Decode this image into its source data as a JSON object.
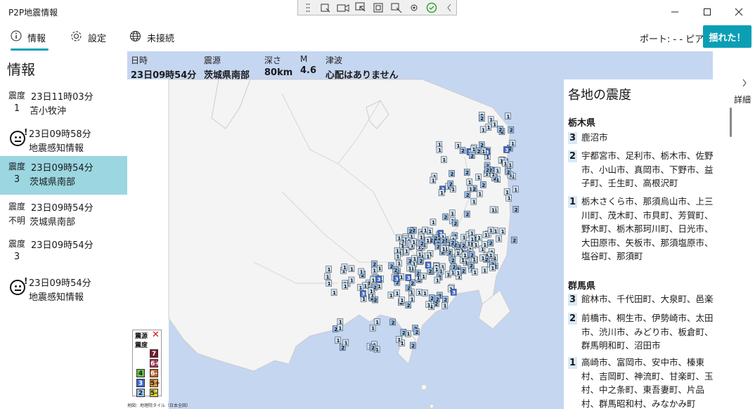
{
  "app_title": "P2P地震情報",
  "toolbar_icons": [
    "select-icon",
    "record-icon",
    "pointer-icon",
    "window-icon",
    "region-icon",
    "settings-icon",
    "check-icon",
    "chevron-left-icon"
  ],
  "nav": {
    "tabs": [
      {
        "icon": "info-icon",
        "label": "情報"
      },
      {
        "icon": "gear-icon",
        "label": "設定"
      },
      {
        "icon": "globe-icon",
        "label": "未接続"
      }
    ],
    "peer_label": "ポート: -  - ピア",
    "shake_button": "揺れた！"
  },
  "sidebar": {
    "title": "情報",
    "items": [
      {
        "type": "quake",
        "k": "震度",
        "intensity": "1",
        "time": "23日11時03分",
        "place": "苫小牧沖"
      },
      {
        "type": "report",
        "time": "23日09時58分",
        "place": "地震感知情報"
      },
      {
        "type": "quake",
        "k": "震度",
        "intensity": "3",
        "time": "23日09時54分",
        "place": "茨城県南部",
        "selected": true
      },
      {
        "type": "quake",
        "k": "震度",
        "intensity": "不明",
        "time": "23日09時54分",
        "place": "茨城県南部"
      },
      {
        "type": "quake",
        "k": "震度",
        "intensity": "3",
        "time": "23日09時54分",
        "place": ""
      },
      {
        "type": "report",
        "time": "23日09時54分",
        "place": "地震感知情報"
      }
    ]
  },
  "header": {
    "datetime_label": "日時",
    "datetime": "23日09時54分",
    "epicenter_label": "震源",
    "epicenter": "茨城県南部",
    "depth_label": "深さ",
    "depth": "80km",
    "mag_label": "M",
    "mag": "4.6",
    "tsunami_label": "津波",
    "tsunami": "心配はありません"
  },
  "detail": {
    "label": "詳細"
  },
  "panel": {
    "title": "各地の震度",
    "prefs": [
      {
        "name": "栃木県",
        "rows": [
          {
            "int": "3",
            "cities": "鹿沼市"
          },
          {
            "int": "2",
            "cities": "宇都宮市、足利市、栃木市、佐野市、小山市、真岡市、下野市、益子町、壬生町、高根沢町"
          },
          {
            "int": "1",
            "cities": "栃木さくら市、那須烏山市、上三川町、茂木町、市貝町、芳賀町、野木町、栃木那珂川町、日光市、大田原市、矢板市、那須塩原市、塩谷町、那須町"
          }
        ]
      },
      {
        "name": "群馬県",
        "rows": [
          {
            "int": "3",
            "cities": "館林市、千代田町、大泉町、邑楽町"
          },
          {
            "int": "2",
            "cities": "前橋市、桐生市、伊勢崎市、太田市、渋川市、みどり市、板倉町、群馬明和町、沼田市"
          },
          {
            "int": "1",
            "cities": "高崎市、富岡市、安中市、榛東村、吉岡町、神流町、甘楽町、玉村、中之条町、東吾妻町、片品村、群馬昭和村、みなかみ町"
          }
        ]
      }
    ]
  },
  "legend": {
    "epicenter_label": "震源",
    "intensity_label": "震度",
    "levels": [
      "7",
      "6+",
      "6-",
      "5+",
      "5-",
      "4",
      "3",
      "2",
      "1"
    ]
  },
  "credit": "地図：地理院タイル（日本全図）",
  "colors": {
    "accent": "#0aa1b5",
    "selected": "#9bd6e1",
    "sea": "#c5d6f1",
    "land": "#f4f4f4",
    "marker": "#cfe3f6"
  }
}
